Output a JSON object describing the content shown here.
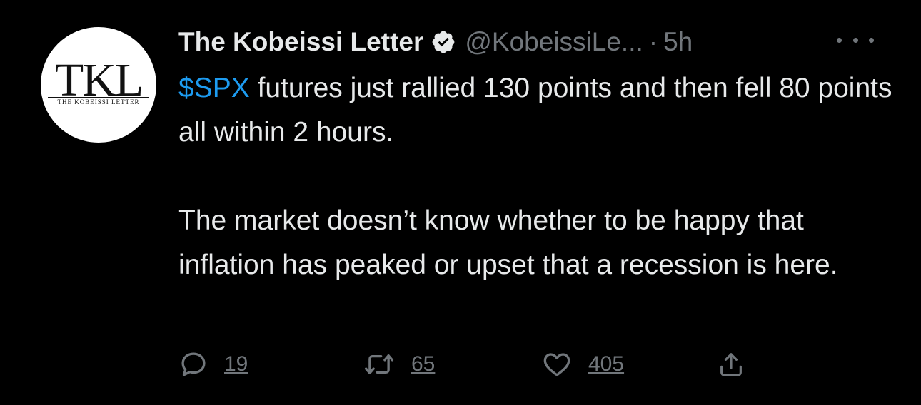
{
  "author": {
    "name": "The Kobeissi Letter",
    "handle": "@KobeissiLe...",
    "separator": "·",
    "time": "5h",
    "avatar_mark": "TKL",
    "avatar_subtitle": "THE KOBEISSI LETTER",
    "verified_icon": "verified-badge-icon"
  },
  "tweet": {
    "cashtag": "$SPX",
    "line1_rest": " futures just rallied 130 points and then fell 80 points all within 2 hours.",
    "paragraph2": "The market doesn’t know whether to be happy that inflation has peaked or upset that a recession is here."
  },
  "actions": {
    "reply_count": "19",
    "retweet_count": "65",
    "like_count": "405"
  },
  "colors": {
    "background": "#000000",
    "text": "#e7e9ea",
    "muted": "#71767b",
    "link": "#1d9bf0"
  }
}
